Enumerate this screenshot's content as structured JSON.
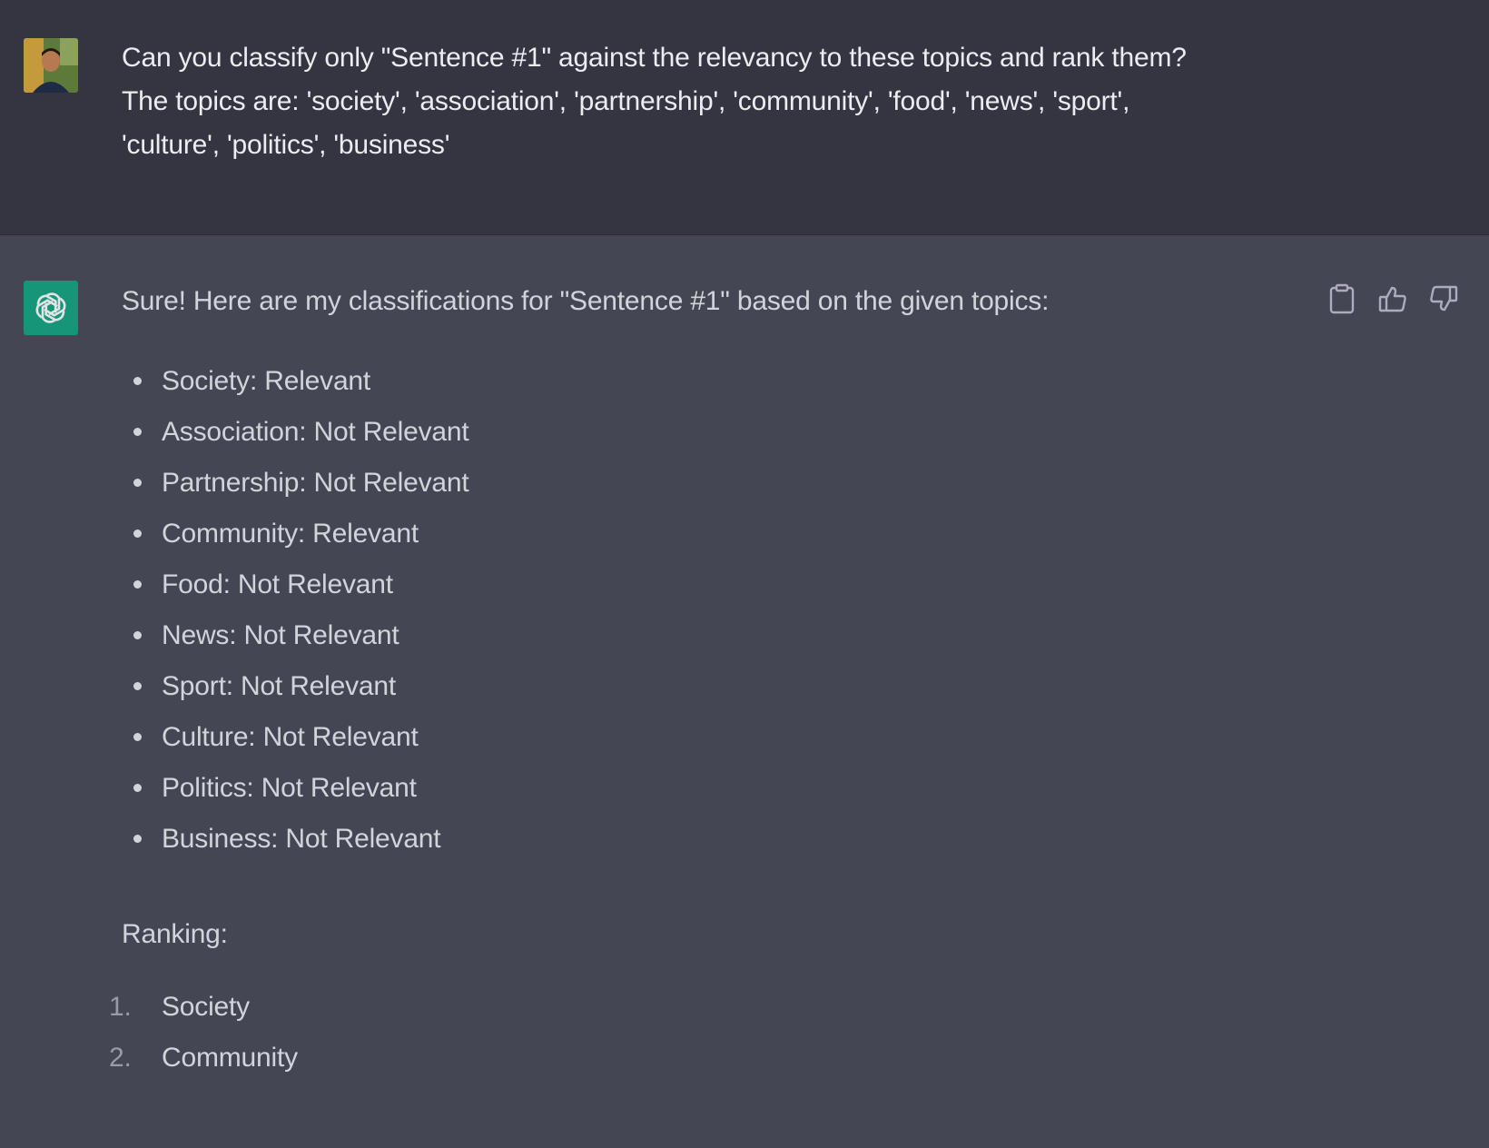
{
  "user_turn": {
    "avatar": "user-avatar-photo",
    "message_lines": [
      "Can you classify only \"Sentence #1\" against the relevancy to these topics and rank them?",
      "The topics are: 'society', 'association', 'partnership', 'community', 'food', 'news', 'sport',",
      "'culture', 'politics', 'business'"
    ]
  },
  "assistant_turn": {
    "avatar": "openai-logo-icon",
    "intro": "Sure! Here are my classifications for \"Sentence #1\" based on the given topics:",
    "actions": {
      "copy": "clipboard-icon",
      "like": "thumbs-up-icon",
      "dislike": "thumbs-down-icon"
    },
    "classifications": [
      "Society: Relevant",
      "Association: Not Relevant",
      "Partnership: Not Relevant",
      "Community: Relevant",
      "Food: Not Relevant",
      "News: Not Relevant",
      "Sport: Not Relevant",
      "Culture: Not Relevant",
      "Politics: Not Relevant",
      "Business: Not Relevant"
    ],
    "ranking_heading": "Ranking:",
    "ranking": [
      {
        "num": "1.",
        "label": "Society"
      },
      {
        "num": "2.",
        "label": "Community"
      }
    ]
  },
  "colors": {
    "user_bg": "#343541",
    "assistant_bg": "#444654",
    "accent": "#10a37f",
    "text": "#d1d5db"
  }
}
